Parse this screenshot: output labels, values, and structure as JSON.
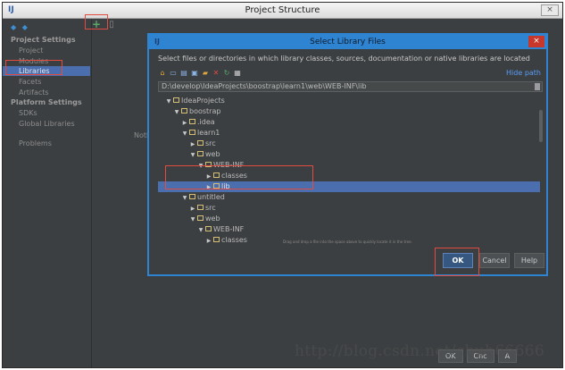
{
  "window": {
    "title": "Project Structure",
    "app_icon": "intellij-icon",
    "close_label": "×"
  },
  "toolbar": {
    "back_forward": "◆ ◆",
    "add_label": "+",
    "remove_label": "▯"
  },
  "sidebar": {
    "project_settings_heading": "Project Settings",
    "platform_settings_heading": "Platform Settings",
    "items": [
      {
        "label": "Project"
      },
      {
        "label": "Modules"
      },
      {
        "label": "Libraries",
        "selected": true
      },
      {
        "label": "Facets"
      },
      {
        "label": "Artifacts"
      },
      {
        "label": "SDKs"
      },
      {
        "label": "Global Libraries"
      },
      {
        "label": "Problems"
      }
    ]
  },
  "main": {
    "nothing_label": "Noth"
  },
  "background_buttons": {
    "ok": "OK",
    "cancel": "Cnc",
    "apply": "A"
  },
  "dialog": {
    "title": "Select Library Files",
    "close_label": "×",
    "instructions": "Select files or directories in which library classes, sources, documentation or native libraries are located",
    "hide_path": "Hide path",
    "path": "D:\\develop\\IdeaProjects\\boostrap\\learn1\\web\\WEB-INF\\lib",
    "toolbar_icons": [
      "home-icon",
      "desktop-icon",
      "project-icon",
      "module-icon",
      "new-folder-icon",
      "delete-icon",
      "refresh-icon",
      "show-hidden-icon"
    ],
    "tree": [
      {
        "label": "IdeaProjects",
        "depth": 0,
        "expanded": true
      },
      {
        "label": "boostrap",
        "depth": 1,
        "expanded": true
      },
      {
        "label": ".idea",
        "depth": 2,
        "expanded": false
      },
      {
        "label": "learn1",
        "depth": 2,
        "expanded": true
      },
      {
        "label": "src",
        "depth": 3,
        "expanded": false
      },
      {
        "label": "web",
        "depth": 3,
        "expanded": true
      },
      {
        "label": "WEB-INF",
        "depth": 4,
        "expanded": true
      },
      {
        "label": "classes",
        "depth": 5,
        "expanded": false
      },
      {
        "label": "lib",
        "depth": 5,
        "expanded": false,
        "selected": true
      },
      {
        "label": "untitled",
        "depth": 2,
        "expanded": true
      },
      {
        "label": "src",
        "depth": 3,
        "expanded": false
      },
      {
        "label": "web",
        "depth": 3,
        "expanded": true
      },
      {
        "label": "WEB-INF",
        "depth": 4,
        "expanded": true
      },
      {
        "label": "classes",
        "depth": 5,
        "expanded": false
      }
    ],
    "drag_hint": "Drag and drop a file into the space above to quickly locate it in the tree.",
    "ok_label": "OK",
    "cancel_label": "Cancel",
    "help_label": "Help"
  },
  "watermark": "http://blog.csdn.net/chuh66666",
  "colors": {
    "accent": "#2f84d2",
    "selection": "#4b6eaf",
    "highlight": "#e24b3f",
    "add_green": "#59a869"
  }
}
